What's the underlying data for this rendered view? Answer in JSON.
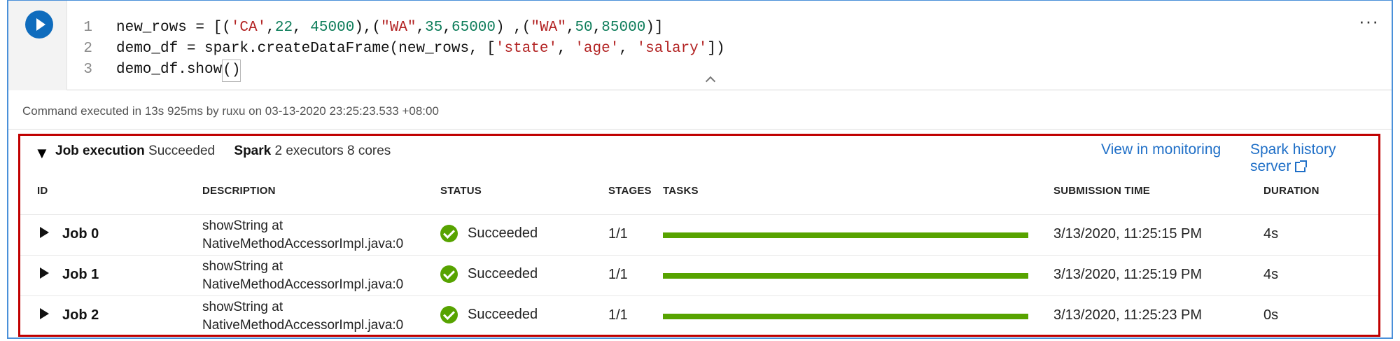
{
  "code": {
    "lines": [
      {
        "number": "1",
        "tokens": [
          {
            "text": "new_rows = [(",
            "type": "default"
          },
          {
            "text": "'CA'",
            "type": "str"
          },
          {
            "text": ",",
            "type": "default"
          },
          {
            "text": "22",
            "type": "num"
          },
          {
            "text": ", ",
            "type": "default"
          },
          {
            "text": "45000",
            "type": "num"
          },
          {
            "text": "),(",
            "type": "default"
          },
          {
            "text": "\"WA\"",
            "type": "str"
          },
          {
            "text": ",",
            "type": "default"
          },
          {
            "text": "35",
            "type": "num"
          },
          {
            "text": ",",
            "type": "default"
          },
          {
            "text": "65000",
            "type": "num"
          },
          {
            "text": ") ,(",
            "type": "default"
          },
          {
            "text": "\"WA\"",
            "type": "str"
          },
          {
            "text": ",",
            "type": "default"
          },
          {
            "text": "50",
            "type": "num"
          },
          {
            "text": ",",
            "type": "default"
          },
          {
            "text": "85000",
            "type": "num"
          },
          {
            "text": ")]",
            "type": "default"
          }
        ]
      },
      {
        "number": "2",
        "tokens": [
          {
            "text": "demo_df = spark.createDataFrame(new_rows, [",
            "type": "default"
          },
          {
            "text": "'state'",
            "type": "str"
          },
          {
            "text": ", ",
            "type": "default"
          },
          {
            "text": "'age'",
            "type": "str"
          },
          {
            "text": ", ",
            "type": "default"
          },
          {
            "text": "'salary'",
            "type": "str"
          },
          {
            "text": "])",
            "type": "default"
          }
        ]
      },
      {
        "number": "3",
        "tokens": [
          {
            "text": "demo_df.show",
            "type": "default"
          },
          {
            "text": "()",
            "type": "default",
            "boxed": true
          }
        ]
      }
    ],
    "more_label": "···"
  },
  "execution": {
    "summary": "Command executed in 13s 925ms by ruxu on 03-13-2020 23:25:23.533 +08:00"
  },
  "job_panel": {
    "toggle_glyph": "▼",
    "job_execution_label": "Job execution",
    "job_execution_status": "Succeeded",
    "spark_label": "Spark",
    "spark_detail": "2 executors 8 cores",
    "links": {
      "monitoring": "View in monitoring",
      "history": "Spark history server"
    },
    "headers": {
      "id": "ID",
      "description": "DESCRIPTION",
      "status": "STATUS",
      "stages": "STAGES",
      "tasks": "TASKS",
      "submission_time": "SUBMISSION TIME",
      "duration": "DURATION"
    },
    "jobs": [
      {
        "id": "Job 0",
        "description_line1": "showString at",
        "description_line2": "NativeMethodAccessorImpl.java:0",
        "status": "Succeeded",
        "stages": "1/1",
        "tasks_progress": 1.0,
        "submission_time": "3/13/2020, 11:25:15 PM",
        "duration": "4s"
      },
      {
        "id": "Job 1",
        "description_line1": "showString at",
        "description_line2": "NativeMethodAccessorImpl.java:0",
        "status": "Succeeded",
        "stages": "1/1",
        "tasks_progress": 1.0,
        "submission_time": "3/13/2020, 11:25:19 PM",
        "duration": "4s"
      },
      {
        "id": "Job 2",
        "description_line1": "showString at",
        "description_line2": "NativeMethodAccessorImpl.java:0",
        "status": "Succeeded",
        "stages": "1/1",
        "tasks_progress": 1.0,
        "submission_time": "3/13/2020, 11:25:23 PM",
        "duration": "0s"
      }
    ]
  },
  "colors": {
    "accent": "#0f6cbd",
    "success": "#57a300",
    "highlight_border": "#c00000",
    "link": "#1f6fc7"
  }
}
